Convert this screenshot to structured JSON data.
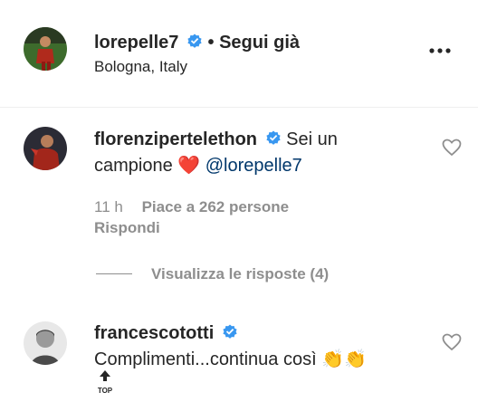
{
  "post_header": {
    "username": "lorepelle7",
    "separator": "•",
    "follow_status": "Segui già",
    "location": "Bologna, Italy"
  },
  "comments": [
    {
      "username": "florenzipertelethon",
      "text_line1": "Sei un",
      "text_line2": "campione",
      "heart_emoji": "❤️",
      "mention": "@lorepelle7",
      "time": "11 h",
      "likes": "Piace a 262 persone",
      "reply": "Rispondi",
      "view_replies": "Visualizza le risposte (4)"
    },
    {
      "username": "francescototti",
      "text": "Complimenti...continua così",
      "emoji": "👏👏"
    }
  ],
  "top_button": {
    "label": "TOP"
  },
  "colors": {
    "verified": "#3897f0",
    "text": "#262626",
    "secondary": "#8e8e8e",
    "mention": "#00376b",
    "heart_emoji": "#e0201c"
  },
  "icons": [
    "verified-badge-icon",
    "more-options-icon",
    "like-heart-icon",
    "arrow-up-icon"
  ]
}
